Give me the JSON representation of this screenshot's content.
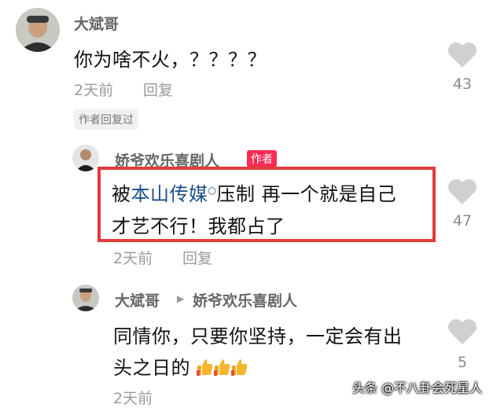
{
  "comments": [
    {
      "user": "大斌哥",
      "text": "你为啥不火，？？？？",
      "time": "2天前",
      "reply": "回复",
      "likes": "43",
      "author_replied": "作者回复过"
    },
    {
      "user": "娇爷欢乐喜剧人",
      "author_badge": "作者",
      "text_prefix": "被",
      "text_link": "本山传媒",
      "text_line1_rest": "压制 再一个就是自己",
      "text_line2": "才艺不行！我都占了",
      "time": "2天前",
      "reply": "回复",
      "likes": "47"
    },
    {
      "user": "大斌哥",
      "reply_to": "娇爷欢乐喜剧人",
      "text_line1": "同情你，只要你坚持，一定会有出",
      "text_line2": "头之日的",
      "emoji": "thumbs-up-icon",
      "likes": "5",
      "time": "2天前"
    }
  ],
  "watermark": "头条 @不八卦会死星人",
  "colors": {
    "highlight": "#e23a3a",
    "author_badge": "#fe2c55",
    "link": "#1b4f8a"
  }
}
